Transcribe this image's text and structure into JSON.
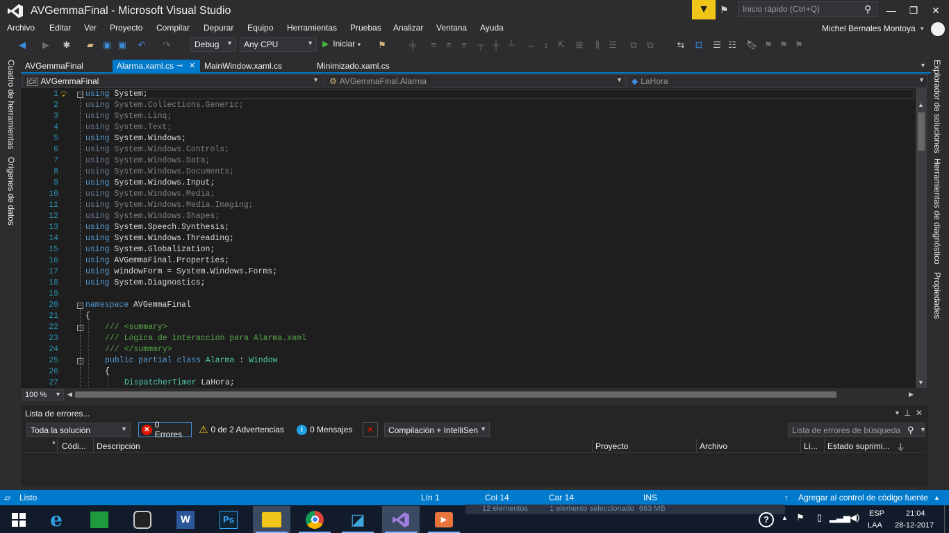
{
  "window": {
    "title": "AVGemmaFinal - Microsoft Visual Studio",
    "quick_launch_placeholder": "Inicio rápido (Ctrl+Q)",
    "user": "Michel Bernales Montoya"
  },
  "menu": [
    "Archivo",
    "Editar",
    "Ver",
    "Proyecto",
    "Compilar",
    "Depurar",
    "Equipo",
    "Herramientas",
    "Pruebas",
    "Analizar",
    "Ventana",
    "Ayuda"
  ],
  "toolbar": {
    "config": "Debug",
    "platform": "Any CPU",
    "start": "Iniciar"
  },
  "left_rail": [
    "Cuadro de herramientas",
    "Orígenes de datos"
  ],
  "right_rail": [
    "Explorador de soluciones",
    "Herramientas de diagnóstico",
    "Propiedades"
  ],
  "tabs": [
    "AVGemmaFinal",
    "Alarma.xaml.cs",
    "MainWindow.xaml.cs",
    "Minimizado.xaml.cs"
  ],
  "nav": {
    "project": "AVGemmaFinal",
    "class": "AVGemmaFinal.Alarma",
    "member": "LaHora"
  },
  "code_lines": [
    {
      "n": "1",
      "kw": "using",
      "rest": " System;",
      "dim": false
    },
    {
      "n": "2",
      "kw": "using",
      "rest": " System.Collections.Generic;",
      "dim": true
    },
    {
      "n": "3",
      "kw": "using",
      "rest": " System.Linq;",
      "dim": true
    },
    {
      "n": "4",
      "kw": "using",
      "rest": " System.Text;",
      "dim": true
    },
    {
      "n": "5",
      "kw": "using",
      "rest": " System.Windows;",
      "dim": false
    },
    {
      "n": "6",
      "kw": "using",
      "rest": " System.Windows.Controls;",
      "dim": true
    },
    {
      "n": "7",
      "kw": "using",
      "rest": " System.Windows.Data;",
      "dim": true
    },
    {
      "n": "8",
      "kw": "using",
      "rest": " System.Windows.Documents;",
      "dim": true
    },
    {
      "n": "9",
      "kw": "using",
      "rest": " System.Windows.Input;",
      "dim": false
    },
    {
      "n": "10",
      "kw": "using",
      "rest": " System.Windows.Media;",
      "dim": true
    },
    {
      "n": "11",
      "kw": "using",
      "rest": " System.Windows.Media.Imaging;",
      "dim": true
    },
    {
      "n": "12",
      "kw": "using",
      "rest": " System.Windows.Shapes;",
      "dim": true
    },
    {
      "n": "13",
      "kw": "using",
      "rest": " System.Speech.Synthesis;",
      "dim": false
    },
    {
      "n": "14",
      "kw": "using",
      "rest": " System.Windows.Threading;",
      "dim": false
    },
    {
      "n": "15",
      "kw": "using",
      "rest": " System.Globalization;",
      "dim": false
    },
    {
      "n": "16",
      "kw": "using",
      "rest": " AVGemmaFinal.Properties;",
      "dim": false
    },
    {
      "n": "17",
      "kw": "using",
      "rest": " windowForm = System.Windows.Forms;",
      "dim": false
    },
    {
      "n": "18",
      "kw": "using",
      "rest": " System.Diagnostics;",
      "dim": false
    }
  ],
  "code_tail": {
    "l19": "19",
    "l20": "20",
    "ns_kw": "namespace",
    "ns_name": " AVGemmaFinal",
    "l21": "21",
    "brace_open": "{",
    "l22": "22",
    "c1": "/// <summary>",
    "l23": "23",
    "c2": "/// Lógica de interacción para Alarma.xaml",
    "l24": "24",
    "c3": "/// </summary>",
    "l25": "25",
    "cls_kw": "public partial class",
    "cls_name": " Alarma",
    "cls_colon": " : ",
    "cls_base": "Window",
    "l26": "26",
    "brace_open2": "{",
    "l27": "27",
    "field_type": "DispatcherTimer",
    "field_name": " LaHora;"
  },
  "zoom": "100 %",
  "error_list": {
    "title": "Lista de errores...",
    "scope": "Toda la solución",
    "errors": "0 Errores",
    "warnings": "0 de 2 Advertencias",
    "messages": "0 Mensajes",
    "build": "Compilación + IntelliSen",
    "search_placeholder": "Lista de errores de búsqueda",
    "columns": [
      "Códi...",
      "Descripción",
      "Proyecto",
      "Archivo",
      "Lí...",
      "Estado suprimi..."
    ]
  },
  "status": {
    "ready": "Listo",
    "line": "Lín 1",
    "col": "Col 14",
    "car": "Car 14",
    "ins": "INS",
    "source_control": "Agregar al control de código fuente"
  },
  "taskbar": {
    "explorer_items": "12 elementos",
    "explorer_selected": "1 elemento seleccionado",
    "explorer_size": "663 MB",
    "lang": "ESP",
    "lang2": "LAA",
    "time": "21:04",
    "date": "28-12-2017"
  },
  "colors": {
    "accent": "#007acc",
    "keyword": "#569cd6",
    "type": "#4ec9b0",
    "comment": "#57a64a",
    "line_number": "#2b91af"
  }
}
